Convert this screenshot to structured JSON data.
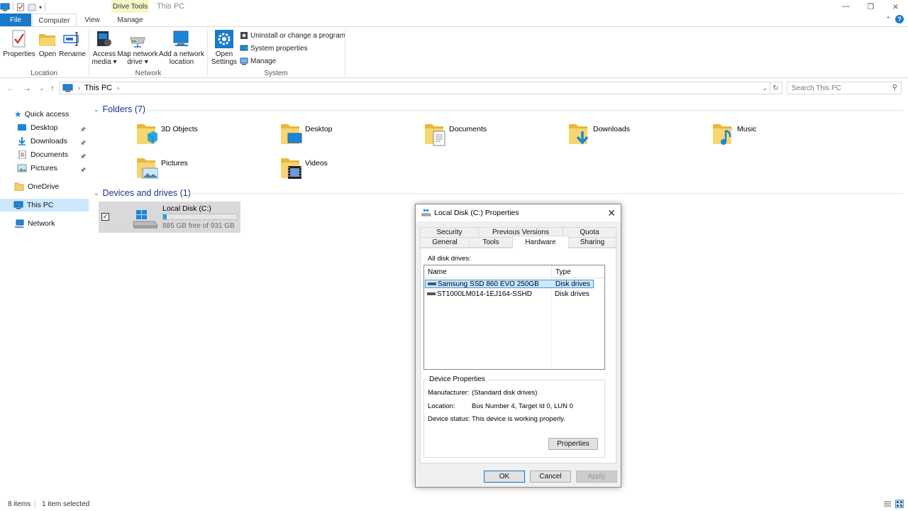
{
  "window": {
    "title": "This PC",
    "context_tab": "Drive Tools",
    "help": "?"
  },
  "tabs": [
    "File",
    "Computer",
    "View",
    "Manage"
  ],
  "ribbon": {
    "location": {
      "label": "Location",
      "buttons": [
        {
          "label": "Properties",
          "icon": "properties-icon"
        },
        {
          "label": "Open",
          "icon": "open-folder-icon"
        },
        {
          "label": "Rename",
          "icon": "rename-icon"
        }
      ]
    },
    "network": {
      "label": "Network",
      "access_media_1": "Access",
      "access_media_2": "media ▾",
      "map_drive_1": "Map network",
      "map_drive_2": "drive ▾",
      "add_location_1": "Add a network",
      "add_location_2": "location"
    },
    "system": {
      "label": "System",
      "open_settings_1": "Open",
      "open_settings_2": "Settings",
      "uninstall": "Uninstall or change a program",
      "system_properties": "System properties",
      "manage": "Manage"
    }
  },
  "address": {
    "crumb": "This PC",
    "search_placeholder": "Search This PC"
  },
  "sidebar": {
    "quick_access": "Quick access",
    "pinned": [
      {
        "label": "Desktop"
      },
      {
        "label": "Downloads"
      },
      {
        "label": "Documents"
      },
      {
        "label": "Pictures"
      }
    ],
    "onedrive": "OneDrive",
    "this_pc": "This PC",
    "network": "Network"
  },
  "content": {
    "folders_header": "Folders (7)",
    "folders": [
      {
        "name": "3D Objects",
        "icon": "3d-objects-folder-icon"
      },
      {
        "name": "Desktop",
        "icon": "desktop-folder-icon"
      },
      {
        "name": "Documents",
        "icon": "documents-folder-icon"
      },
      {
        "name": "Downloads",
        "icon": "downloads-folder-icon"
      },
      {
        "name": "Music",
        "icon": "music-folder-icon"
      },
      {
        "name": "Pictures",
        "icon": "pictures-folder-icon"
      },
      {
        "name": "Videos",
        "icon": "videos-folder-icon"
      }
    ],
    "drives_header": "Devices and drives (1)",
    "drive": {
      "name": "Local Disk (C:)",
      "free_text": "885 GB free of 931 GB",
      "used_fraction": 0.05,
      "bar_color": "#26a0da"
    }
  },
  "status": {
    "items": "8 items",
    "selected": "1 item selected"
  },
  "dialog": {
    "title": "Local Disk (C:) Properties",
    "tabs_row1": [
      "Security",
      "Previous Versions",
      "Quota"
    ],
    "tabs_row2": [
      "General",
      "Tools",
      "Hardware",
      "Sharing"
    ],
    "active_tab": "Hardware",
    "all_disk_drives": "All disk drives:",
    "col_name": "Name",
    "col_type": "Type",
    "drives": [
      {
        "name": "Samsung SSD 860 EVO 250GB",
        "type": "Disk drives"
      },
      {
        "name": "ST1000LM014-1EJ164-SSHD",
        "type": "Disk drives"
      }
    ],
    "device_properties": "Device Properties",
    "manufacturer_label": "Manufacturer:",
    "manufacturer_value": "(Standard disk drives)",
    "location_label": "Location:",
    "location_value": "Bus Number 4, Target Id 0, LUN 0",
    "status_label": "Device status:",
    "status_value": "This device is working properly.",
    "properties_button": "Properties",
    "ok": "OK",
    "cancel": "Cancel",
    "apply": "Apply"
  }
}
